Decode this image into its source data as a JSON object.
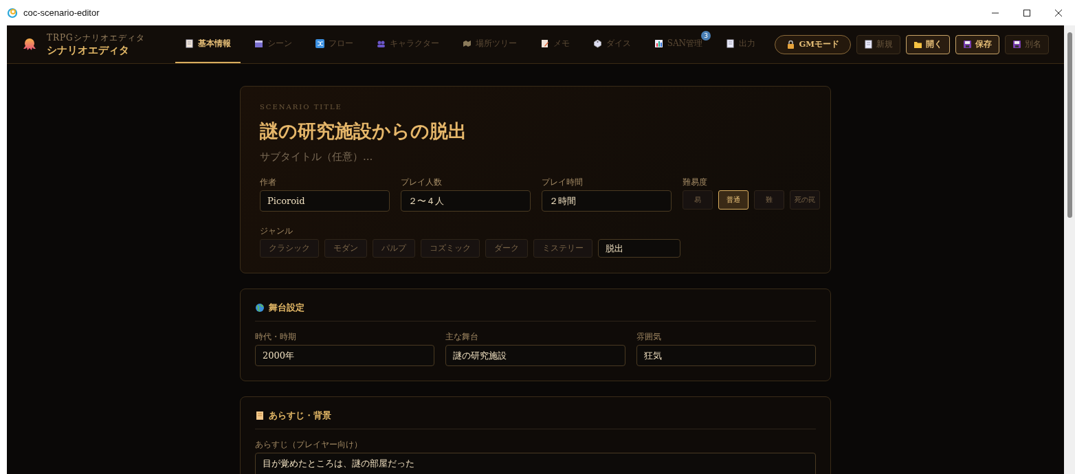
{
  "window": {
    "title": "coc-scenario-editor"
  },
  "header": {
    "brand_subtitle": "TRPGシナリオエディタ",
    "brand_title": "シナリオエディタ",
    "tabs": [
      {
        "label": "基本情報",
        "selected": true
      },
      {
        "label": "シーン",
        "selected": false
      },
      {
        "label": "フロー",
        "selected": false
      },
      {
        "label": "キャラクター",
        "selected": false
      },
      {
        "label": "場所ツリー",
        "selected": false
      },
      {
        "label": "メモ",
        "selected": false
      },
      {
        "label": "ダイス",
        "selected": false
      },
      {
        "label": "SAN管理",
        "selected": false,
        "badge": "3"
      },
      {
        "label": "出力",
        "selected": false
      }
    ],
    "buttons": [
      {
        "label": "GMモード",
        "kind": "pill",
        "disabled": false
      },
      {
        "label": "新規",
        "kind": "plain",
        "disabled": true
      },
      {
        "label": "開く",
        "kind": "plain",
        "disabled": false
      },
      {
        "label": "保存",
        "kind": "plain",
        "disabled": false
      },
      {
        "label": "別名",
        "kind": "plain",
        "disabled": true
      }
    ]
  },
  "title_card": {
    "eyebrow": "SCENARIO TITLE",
    "title": "謎の研究施設からの脱出",
    "subtitle": {
      "placeholder": "サブタイトル（任意）..."
    },
    "fields": [
      {
        "label": "作者",
        "value": "Picoroid"
      },
      {
        "label": "プレイ人数",
        "value": "２〜４人"
      },
      {
        "label": "プレイ時間",
        "value": "２時間"
      }
    ],
    "difficulty": {
      "label": "難易度",
      "options": [
        {
          "label": "易",
          "selected": false
        },
        {
          "label": "普通",
          "selected": true
        },
        {
          "label": "難",
          "selected": false
        },
        {
          "label": "死の罠",
          "selected": false
        }
      ]
    },
    "genre": {
      "label": "ジャンル",
      "options": [
        {
          "label": "クラシック",
          "selected": false
        },
        {
          "label": "モダン",
          "selected": false
        },
        {
          "label": "パルプ",
          "selected": false
        },
        {
          "label": "コズミック",
          "selected": false
        },
        {
          "label": "ダーク",
          "selected": false
        },
        {
          "label": "ミステリー",
          "selected": false
        }
      ],
      "custom_value": "脱出"
    }
  },
  "sections": [
    {
      "title": "舞台設定",
      "kind": "fields",
      "fields": [
        {
          "label": "時代・時期",
          "value": "2000年"
        },
        {
          "label": "主な舞台",
          "value": "謎の研究施設"
        },
        {
          "label": "雰囲気",
          "value": "狂気"
        }
      ]
    },
    {
      "title": "あらすじ・背景",
      "kind": "textarea",
      "fields": [
        {
          "label": "あらすじ（プレイヤー向け）",
          "value": "目が覚めたところは、謎の部屋だった"
        }
      ]
    }
  ]
}
